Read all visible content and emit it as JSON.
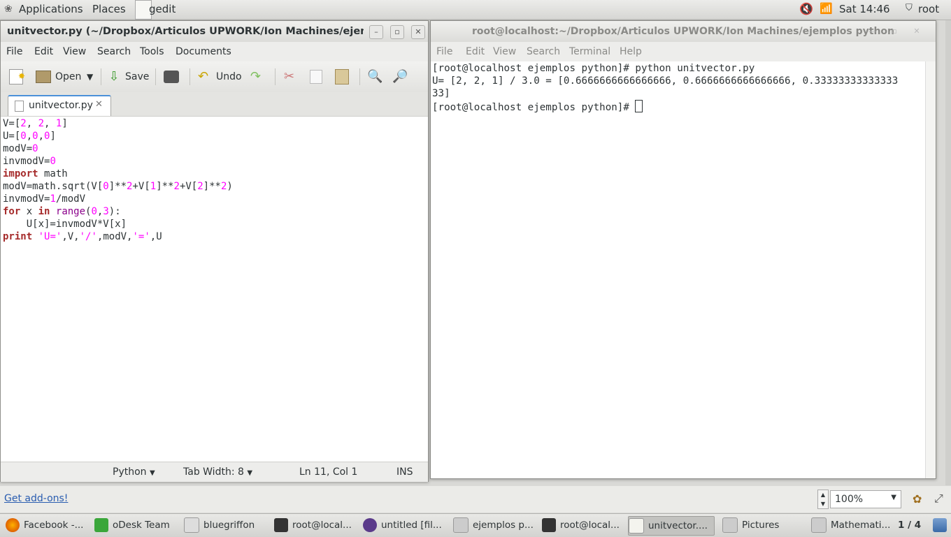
{
  "top_panel": {
    "applications": "Applications",
    "places": "Places",
    "active_app": "gedit",
    "clock": "Sat 14:46",
    "user": "root"
  },
  "gedit": {
    "title": "unitvector.py (~/Dropbox/Articulos UPWORK/Ion Machines/ejemplos...",
    "menu": [
      "File",
      "Edit",
      "View",
      "Search",
      "Tools",
      "Documents"
    ],
    "toolbar": {
      "open": "Open",
      "save": "Save",
      "undo": "Undo"
    },
    "tab_name": "unitvector.py",
    "status": {
      "language": "Python",
      "tab_width": "Tab Width:  8",
      "position": "Ln 11, Col 1",
      "mode": "INS"
    }
  },
  "code": [
    "V=[2, 2, 1]",
    "U=[0,0,0]",
    "modV=0",
    "invmodV=0",
    "import math",
    "modV=math.sqrt(V[0]**2+V[1]**2+V[2]**2)",
    "invmodV=1/modV",
    "for x in range(0,3):",
    "    U[x]=invmodV*V[x]",
    "print 'U=',V,'/',modV,'=',U"
  ],
  "terminal": {
    "title": "root@localhost:~/Dropbox/Articulos UPWORK/Ion Machines/ejemplos python",
    "menu": [
      "File",
      "Edit",
      "View",
      "Search",
      "Terminal",
      "Help"
    ],
    "lines": [
      "[root@localhost ejemplos python]# python unitvector.py",
      "U= [2, 2, 1] / 3.0 = [0.6666666666666666, 0.6666666666666666, 0.33333333333333",
      "33]",
      "[root@localhost ejemplos python]# "
    ]
  },
  "background_window": {
    "addons_link": "Get add-ons!",
    "zoom": "100%"
  },
  "taskbar": {
    "items": [
      "Facebook -...",
      "oDesk Team",
      "bluegriffon",
      "root@local...",
      "untitled [fil...",
      "ejemplos p...",
      "root@local...",
      "unitvector....",
      "Pictures",
      "Mathemati..."
    ],
    "workspace": "1 / 4"
  },
  "colors": {
    "keyword": "#a52a2a",
    "number": "#ff00ff",
    "builtin": "#8b008b",
    "tab_accent": "#4a90d9"
  }
}
